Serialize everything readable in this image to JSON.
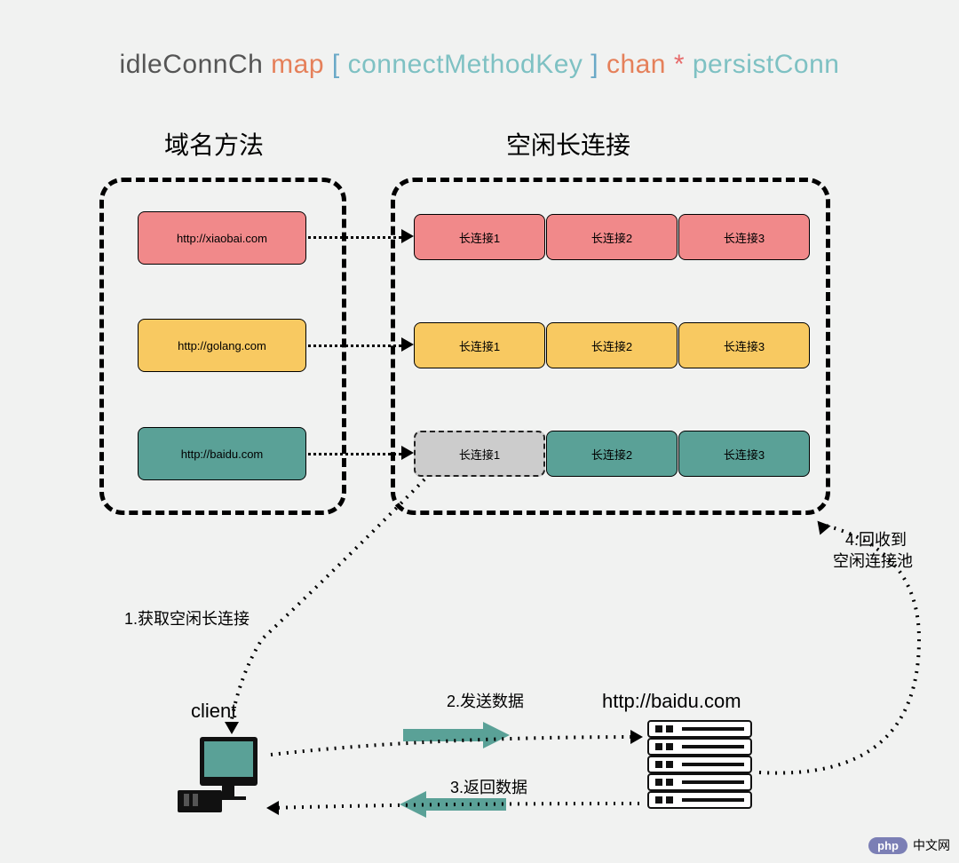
{
  "title": {
    "idleConnCh": "idleConnCh",
    "map": "map",
    "lbracket": "[",
    "connectMethodKey": "connectMethodKey",
    "rbracket": "]",
    "chan": "chan",
    "star": "*",
    "persistConn": "persistConn"
  },
  "subtitles": {
    "left": "域名方法",
    "right": "空闲长连接"
  },
  "domains": {
    "d1": "http://xiaobai.com",
    "d2": "http://golang.com",
    "d3": "http://baidu.com"
  },
  "conns": {
    "r1c1": "长连接1",
    "r1c2": "长连接2",
    "r1c3": "长连接3",
    "r2c1": "长连接1",
    "r2c2": "长连接2",
    "r2c3": "长连接3",
    "r3c1": "长连接1",
    "r3c2": "长连接2",
    "r3c3": "长连接3"
  },
  "steps": {
    "s1": "1.获取空闲长连接",
    "s2": "2.发送数据",
    "s3": "3.返回数据",
    "s4a": "4.回收到",
    "s4b": "空闲连接池"
  },
  "labels": {
    "client": "client",
    "server_url": "http://baidu.com"
  },
  "watermark": {
    "text": "中文网",
    "php": "php"
  }
}
